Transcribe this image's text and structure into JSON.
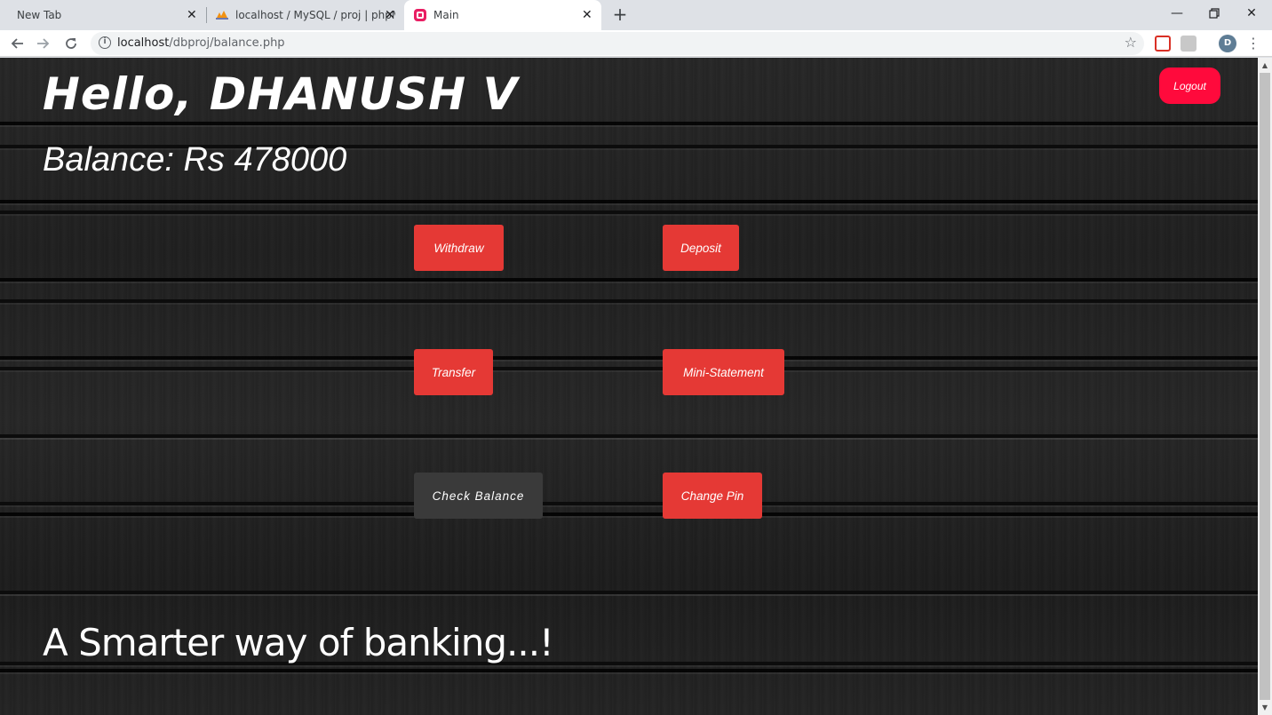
{
  "browser": {
    "tabs": [
      {
        "title": "New Tab"
      },
      {
        "title": "localhost / MySQL / proj | phpMy"
      },
      {
        "title": "Main"
      }
    ],
    "url_host": "localhost",
    "url_path": "/dbproj/balance.php",
    "profile_initial": "D",
    "icons": {
      "back": "back-arrow-icon",
      "forward": "forward-arrow-icon",
      "reload": "reload-icon",
      "info": "info-icon",
      "star": "bookmark-star-icon",
      "menu": "kebab-menu-icon"
    }
  },
  "page": {
    "greeting": "Hello, DHANUSH V",
    "balance": "Balance: Rs 478000",
    "logout_label": "Logout",
    "buttons": {
      "withdraw": "Withdraw",
      "deposit": "Deposit",
      "transfer": "Transfer",
      "mini_statement": "Mini-Statement",
      "check_balance": "Check Balance",
      "change_pin": "Change Pin"
    },
    "tagline": "A Smarter way of banking...!"
  },
  "colors": {
    "action_button": "#e53935",
    "active_button": "#3a3a3a",
    "logout_button": "#ff0a3c",
    "background": "#232323"
  }
}
